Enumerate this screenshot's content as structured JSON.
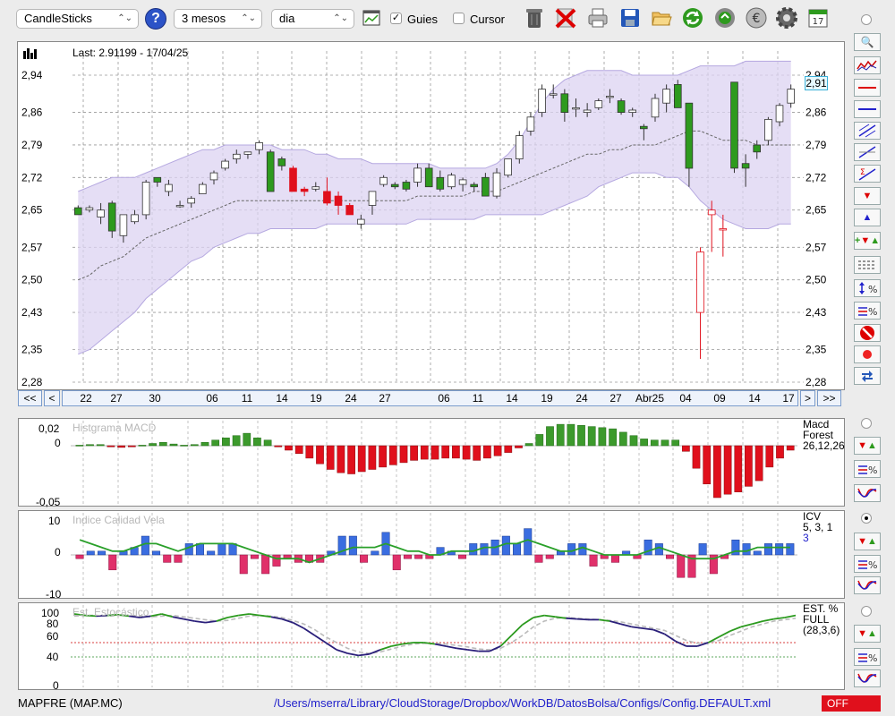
{
  "toolbar": {
    "chart_type": "CandleSticks",
    "period": "3 mesos",
    "interval": "dia",
    "help": "?",
    "guides_label": "Guies",
    "guides_checked": true,
    "cursor_label": "Cursor",
    "cursor_checked": false
  },
  "main_chart": {
    "last_label": "Last: 2.91199 - 17/04/25",
    "current_price_tag": "2,91",
    "y_ticks": [
      "2,94",
      "2,86",
      "2,79",
      "2,72",
      "2,65",
      "2,57",
      "2,50",
      "2,43",
      "2,35",
      "2,28"
    ],
    "y_tick_values": [
      2.94,
      2.86,
      2.79,
      2.72,
      2.65,
      2.57,
      2.5,
      2.43,
      2.35,
      2.28
    ],
    "x_labels": [
      "22",
      "27",
      "30",
      "06",
      "11",
      "14",
      "19",
      "24",
      "27",
      "06",
      "11",
      "14",
      "19",
      "24",
      "27",
      "Abr25",
      "04",
      "09",
      "14",
      "17"
    ],
    "nav_left2": "<<",
    "nav_left1": "<",
    "nav_right1": ">",
    "nav_right2": ">>"
  },
  "macd_panel": {
    "title": "Histgrama MACD",
    "y_top": "0,02",
    "y_zero": "0",
    "y_bottom": "-0,05",
    "legend1": "Macd",
    "legend2": "Forest",
    "legend3": "26,12,26"
  },
  "icv_panel": {
    "title": "Indice Calidad Vela",
    "y_top": "10",
    "y_zero": "0",
    "y_bottom": "-10",
    "legend1": "ICV",
    "legend2": "5, 3, 1",
    "legend3": "3"
  },
  "stoch_panel": {
    "title": "Est. Estocástico",
    "y_ticks": [
      "100",
      "80",
      "60",
      "40",
      "0"
    ],
    "legend1": "EST. %",
    "legend2": "FULL",
    "legend3": "(28,3,6)"
  },
  "status": {
    "symbol": "MAPFRE (MAP.MC)",
    "config_path": "/Users/mserra/Library/CloudStorage/Dropbox/WorkDB/DatosBolsa/Configs/Config.DEFAULT.xml",
    "off_label": "OFF"
  },
  "colors": {
    "up": "#2e9a1e",
    "down": "#e0101c",
    "band": "#dcd3f2",
    "macd_pos": "#3c9a2c",
    "macd_neg": "#e0101c",
    "icv_pos": "#3a6de0",
    "icv_neg": "#e0306a",
    "signal": "#2aa02a",
    "stoch_k": "#2b9a1e",
    "stoch_d": "#bbbbbb",
    "off_bg": "#e0101c"
  },
  "chart_data": [
    {
      "type": "candlestick",
      "title": "",
      "ylim": [
        2.28,
        2.97
      ],
      "candles": [
        {
          "o": 2.655,
          "h": 2.66,
          "l": 2.64,
          "c": 2.64
        },
        {
          "o": 2.65,
          "h": 2.66,
          "l": 2.645,
          "c": 2.655
        },
        {
          "o": 2.635,
          "h": 2.665,
          "l": 2.62,
          "c": 2.65
        },
        {
          "o": 2.665,
          "h": 2.67,
          "l": 2.59,
          "c": 2.605
        },
        {
          "o": 2.595,
          "h": 2.64,
          "l": 2.58,
          "c": 2.64
        },
        {
          "o": 2.625,
          "h": 2.65,
          "l": 2.62,
          "c": 2.64
        },
        {
          "o": 2.64,
          "h": 2.715,
          "l": 2.63,
          "c": 2.71
        },
        {
          "o": 2.72,
          "h": 2.72,
          "l": 2.7,
          "c": 2.71
        },
        {
          "o": 2.69,
          "h": 2.715,
          "l": 2.68,
          "c": 2.705
        },
        {
          "o": 2.66,
          "h": 2.67,
          "l": 2.655,
          "c": 2.66
        },
        {
          "o": 2.665,
          "h": 2.68,
          "l": 2.655,
          "c": 2.675
        },
        {
          "o": 2.685,
          "h": 2.71,
          "l": 2.685,
          "c": 2.705
        },
        {
          "o": 2.715,
          "h": 2.735,
          "l": 2.705,
          "c": 2.73
        },
        {
          "o": 2.74,
          "h": 2.76,
          "l": 2.735,
          "c": 2.755
        },
        {
          "o": 2.76,
          "h": 2.78,
          "l": 2.75,
          "c": 2.77
        },
        {
          "o": 2.77,
          "h": 2.775,
          "l": 2.76,
          "c": 2.775
        },
        {
          "o": 2.78,
          "h": 2.8,
          "l": 2.77,
          "c": 2.795
        },
        {
          "o": 2.775,
          "h": 2.78,
          "l": 2.69,
          "c": 2.69
        },
        {
          "o": 2.76,
          "h": 2.765,
          "l": 2.735,
          "c": 2.745
        },
        {
          "o": 2.74,
          "h": 2.745,
          "l": 2.69,
          "c": 2.69
        },
        {
          "o": 2.695,
          "h": 2.7,
          "l": 2.68,
          "c": 2.69
        },
        {
          "o": 2.695,
          "h": 2.71,
          "l": 2.69,
          "c": 2.7
        },
        {
          "o": 2.69,
          "h": 2.72,
          "l": 2.66,
          "c": 2.665
        },
        {
          "o": 2.68,
          "h": 2.69,
          "l": 2.64,
          "c": 2.66
        },
        {
          "o": 2.66,
          "h": 2.665,
          "l": 2.64,
          "c": 2.64
        },
        {
          "o": 2.62,
          "h": 2.64,
          "l": 2.61,
          "c": 2.63
        },
        {
          "o": 2.66,
          "h": 2.69,
          "l": 2.64,
          "c": 2.69
        },
        {
          "o": 2.705,
          "h": 2.725,
          "l": 2.7,
          "c": 2.72
        },
        {
          "o": 2.705,
          "h": 2.71,
          "l": 2.695,
          "c": 2.7
        },
        {
          "o": 2.71,
          "h": 2.715,
          "l": 2.69,
          "c": 2.695
        },
        {
          "o": 2.71,
          "h": 2.75,
          "l": 2.7,
          "c": 2.74
        },
        {
          "o": 2.74,
          "h": 2.75,
          "l": 2.7,
          "c": 2.7
        },
        {
          "o": 2.72,
          "h": 2.735,
          "l": 2.69,
          "c": 2.695
        },
        {
          "o": 2.7,
          "h": 2.73,
          "l": 2.695,
          "c": 2.725
        },
        {
          "o": 2.705,
          "h": 2.72,
          "l": 2.69,
          "c": 2.715
        },
        {
          "o": 2.705,
          "h": 2.71,
          "l": 2.69,
          "c": 2.7
        },
        {
          "o": 2.72,
          "h": 2.73,
          "l": 2.68,
          "c": 2.68
        },
        {
          "o": 2.68,
          "h": 2.74,
          "l": 2.675,
          "c": 2.73
        },
        {
          "o": 2.725,
          "h": 2.76,
          "l": 2.72,
          "c": 2.76
        },
        {
          "o": 2.76,
          "h": 2.82,
          "l": 2.75,
          "c": 2.81
        },
        {
          "o": 2.82,
          "h": 2.86,
          "l": 2.81,
          "c": 2.85
        },
        {
          "o": 2.86,
          "h": 2.92,
          "l": 2.85,
          "c": 2.91
        },
        {
          "o": 2.9,
          "h": 2.92,
          "l": 2.89,
          "c": 2.9
        },
        {
          "o": 2.9,
          "h": 2.91,
          "l": 2.84,
          "c": 2.86
        },
        {
          "o": 2.87,
          "h": 2.89,
          "l": 2.85,
          "c": 2.87
        },
        {
          "o": 2.86,
          "h": 2.88,
          "l": 2.85,
          "c": 2.865
        },
        {
          "o": 2.87,
          "h": 2.89,
          "l": 2.865,
          "c": 2.885
        },
        {
          "o": 2.895,
          "h": 2.91,
          "l": 2.88,
          "c": 2.895
        },
        {
          "o": 2.885,
          "h": 2.89,
          "l": 2.855,
          "c": 2.86
        },
        {
          "o": 2.86,
          "h": 2.87,
          "l": 2.85,
          "c": 2.865
        },
        {
          "o": 2.83,
          "h": 2.835,
          "l": 2.8,
          "c": 2.825
        },
        {
          "o": 2.85,
          "h": 2.9,
          "l": 2.84,
          "c": 2.89
        },
        {
          "o": 2.88,
          "h": 2.92,
          "l": 2.86,
          "c": 2.91
        },
        {
          "o": 2.92,
          "h": 2.93,
          "l": 2.87,
          "c": 2.87
        },
        {
          "o": 2.88,
          "h": 2.88,
          "l": 2.7,
          "c": 2.74
        },
        {
          "o": 2.43,
          "h": 2.57,
          "l": 2.33,
          "c": 2.56
        },
        {
          "o": 2.64,
          "h": 2.67,
          "l": 2.56,
          "c": 2.65
        },
        {
          "o": 2.61,
          "h": 2.64,
          "l": 2.55,
          "c": 2.61
        },
        {
          "o": 2.925,
          "h": 2.925,
          "l": 2.73,
          "c": 2.74
        },
        {
          "o": 2.75,
          "h": 2.77,
          "l": 2.7,
          "c": 2.74
        },
        {
          "o": 2.79,
          "h": 2.8,
          "l": 2.76,
          "c": 2.775
        },
        {
          "o": 2.8,
          "h": 2.85,
          "l": 2.79,
          "c": 2.845
        },
        {
          "o": 2.84,
          "h": 2.88,
          "l": 2.83,
          "c": 2.875
        },
        {
          "o": 2.88,
          "h": 2.92,
          "l": 2.87,
          "c": 2.91
        }
      ],
      "bollinger_upper": [
        2.69,
        2.7,
        2.71,
        2.72,
        2.72,
        2.72,
        2.73,
        2.74,
        2.75,
        2.76,
        2.77,
        2.78,
        2.78,
        2.79,
        2.79,
        2.79,
        2.79,
        2.79,
        2.78,
        2.78,
        2.78,
        2.77,
        2.77,
        2.76,
        2.76,
        2.76,
        2.75,
        2.75,
        2.75,
        2.75,
        2.75,
        2.75,
        2.74,
        2.74,
        2.74,
        2.74,
        2.74,
        2.75,
        2.77,
        2.8,
        2.84,
        2.88,
        2.91,
        2.93,
        2.94,
        2.95,
        2.95,
        2.95,
        2.95,
        2.94,
        2.94,
        2.94,
        2.94,
        2.94,
        2.95,
        2.96,
        2.96,
        2.96,
        2.96,
        2.97,
        2.97,
        2.97,
        2.97,
        2.97
      ],
      "bollinger_lower": [
        2.34,
        2.35,
        2.37,
        2.39,
        2.41,
        2.43,
        2.46,
        2.48,
        2.5,
        2.52,
        2.54,
        2.55,
        2.57,
        2.58,
        2.59,
        2.6,
        2.6,
        2.61,
        2.61,
        2.61,
        2.61,
        2.61,
        2.62,
        2.62,
        2.62,
        2.62,
        2.62,
        2.62,
        2.62,
        2.62,
        2.63,
        2.63,
        2.63,
        2.63,
        2.63,
        2.63,
        2.64,
        2.64,
        2.64,
        2.64,
        2.64,
        2.64,
        2.65,
        2.66,
        2.67,
        2.68,
        2.7,
        2.71,
        2.72,
        2.73,
        2.73,
        2.73,
        2.72,
        2.72,
        2.7,
        2.67,
        2.65,
        2.63,
        2.62,
        2.61,
        2.61,
        2.61,
        2.62,
        2.62
      ],
      "sma": [
        2.5,
        2.51,
        2.53,
        2.54,
        2.55,
        2.57,
        2.59,
        2.6,
        2.61,
        2.62,
        2.63,
        2.64,
        2.65,
        2.66,
        2.67,
        2.67,
        2.67,
        2.67,
        2.67,
        2.67,
        2.67,
        2.67,
        2.67,
        2.67,
        2.67,
        2.67,
        2.67,
        2.67,
        2.67,
        2.67,
        2.68,
        2.68,
        2.68,
        2.68,
        2.68,
        2.69,
        2.69,
        2.69,
        2.7,
        2.71,
        2.72,
        2.73,
        2.74,
        2.75,
        2.76,
        2.77,
        2.77,
        2.78,
        2.78,
        2.79,
        2.79,
        2.79,
        2.8,
        2.81,
        2.82,
        2.82,
        2.81,
        2.8,
        2.8,
        2.8,
        2.79,
        2.79,
        2.79,
        2.79
      ]
    },
    {
      "type": "bar",
      "title": "Histgrama MACD",
      "ylim": [
        -0.055,
        0.025
      ],
      "values": [
        0.0005,
        0.001,
        0.001,
        -0.001,
        -0.0015,
        -0.001,
        0.0005,
        0.002,
        0.003,
        0.0015,
        0.0005,
        0.001,
        0.003,
        0.005,
        0.007,
        0.009,
        0.011,
        0.007,
        0.005,
        -0.001,
        -0.004,
        -0.007,
        -0.011,
        -0.016,
        -0.021,
        -0.024,
        -0.025,
        -0.023,
        -0.021,
        -0.019,
        -0.017,
        -0.015,
        -0.013,
        -0.012,
        -0.012,
        -0.011,
        -0.011,
        -0.012,
        -0.013,
        -0.011,
        -0.009,
        -0.006,
        -0.002,
        0.002,
        0.01,
        0.017,
        0.019,
        0.019,
        0.018,
        0.017,
        0.016,
        0.015,
        0.012,
        0.009,
        0.006,
        0.005,
        0.005,
        0.005,
        -0.005,
        -0.02,
        -0.034,
        -0.046,
        -0.043,
        -0.041,
        -0.036,
        -0.031,
        -0.019,
        -0.011,
        -0.004
      ]
    },
    {
      "type": "bar",
      "title": "Indice Calidad Vela",
      "ylim": [
        -11,
        11
      ],
      "values": [
        -1,
        1,
        1,
        -4,
        1,
        2,
        5,
        1,
        -2,
        -2,
        3,
        3,
        1,
        3,
        3,
        -5,
        -1,
        -5,
        -3,
        -1,
        -2,
        -2,
        -2,
        1,
        5,
        5,
        -2,
        1,
        6,
        -4,
        -1,
        -1,
        -1,
        2,
        1,
        -1,
        3,
        3,
        4,
        5,
        3,
        7,
        -2,
        -1,
        1,
        3,
        3,
        -3,
        -1,
        -2,
        1,
        -1,
        4,
        3,
        -1,
        -6,
        -6,
        3,
        -5,
        -1,
        4,
        3,
        1,
        3,
        3,
        3
      ],
      "signal": [
        4,
        3,
        2,
        1,
        1,
        2,
        3,
        3,
        2,
        1,
        2,
        3,
        3,
        3,
        3,
        2,
        1,
        0,
        -1,
        -1,
        -1,
        -2,
        -1,
        0,
        1,
        2,
        2,
        2,
        3,
        2,
        1,
        1,
        0,
        0,
        1,
        1,
        1,
        2,
        2,
        3,
        3,
        4,
        3,
        2,
        1,
        1,
        2,
        1,
        0,
        0,
        0,
        0,
        1,
        2,
        1,
        0,
        -1,
        -1,
        -1,
        0,
        1,
        1,
        2,
        2,
        2,
        2
      ]
    },
    {
      "type": "line",
      "title": "Est. Estocástico",
      "ylim": [
        0,
        105
      ],
      "series": [
        {
          "values": [
            100,
            98,
            97,
            98,
            99,
            97,
            95,
            97,
            100,
            96,
            93,
            90,
            88,
            90,
            95,
            98,
            100,
            98,
            96,
            93,
            88,
            80,
            70,
            60,
            50,
            45,
            42,
            44,
            50,
            55,
            58,
            60,
            60,
            58,
            55,
            52,
            50,
            48,
            48,
            55,
            70,
            85,
            95,
            98,
            96,
            94,
            93,
            92,
            92,
            90,
            86,
            82,
            80,
            78,
            72,
            62,
            55,
            55,
            60,
            68,
            76,
            82,
            86,
            90,
            93,
            95,
            98
          ]
        },
        {
          "values": [
            97,
            98,
            98,
            97,
            98,
            98,
            97,
            96,
            97,
            98,
            96,
            94,
            92,
            90,
            91,
            94,
            97,
            98,
            97,
            95,
            91,
            86,
            78,
            68,
            60,
            52,
            47,
            45,
            47,
            51,
            55,
            58,
            59,
            59,
            58,
            56,
            54,
            51,
            50,
            52,
            60,
            70,
            82,
            90,
            94,
            95,
            94,
            93,
            92,
            91,
            89,
            86,
            83,
            80,
            77,
            70,
            63,
            59,
            60,
            63,
            70,
            76,
            82,
            86,
            90,
            92,
            94
          ]
        }
      ]
    }
  ]
}
